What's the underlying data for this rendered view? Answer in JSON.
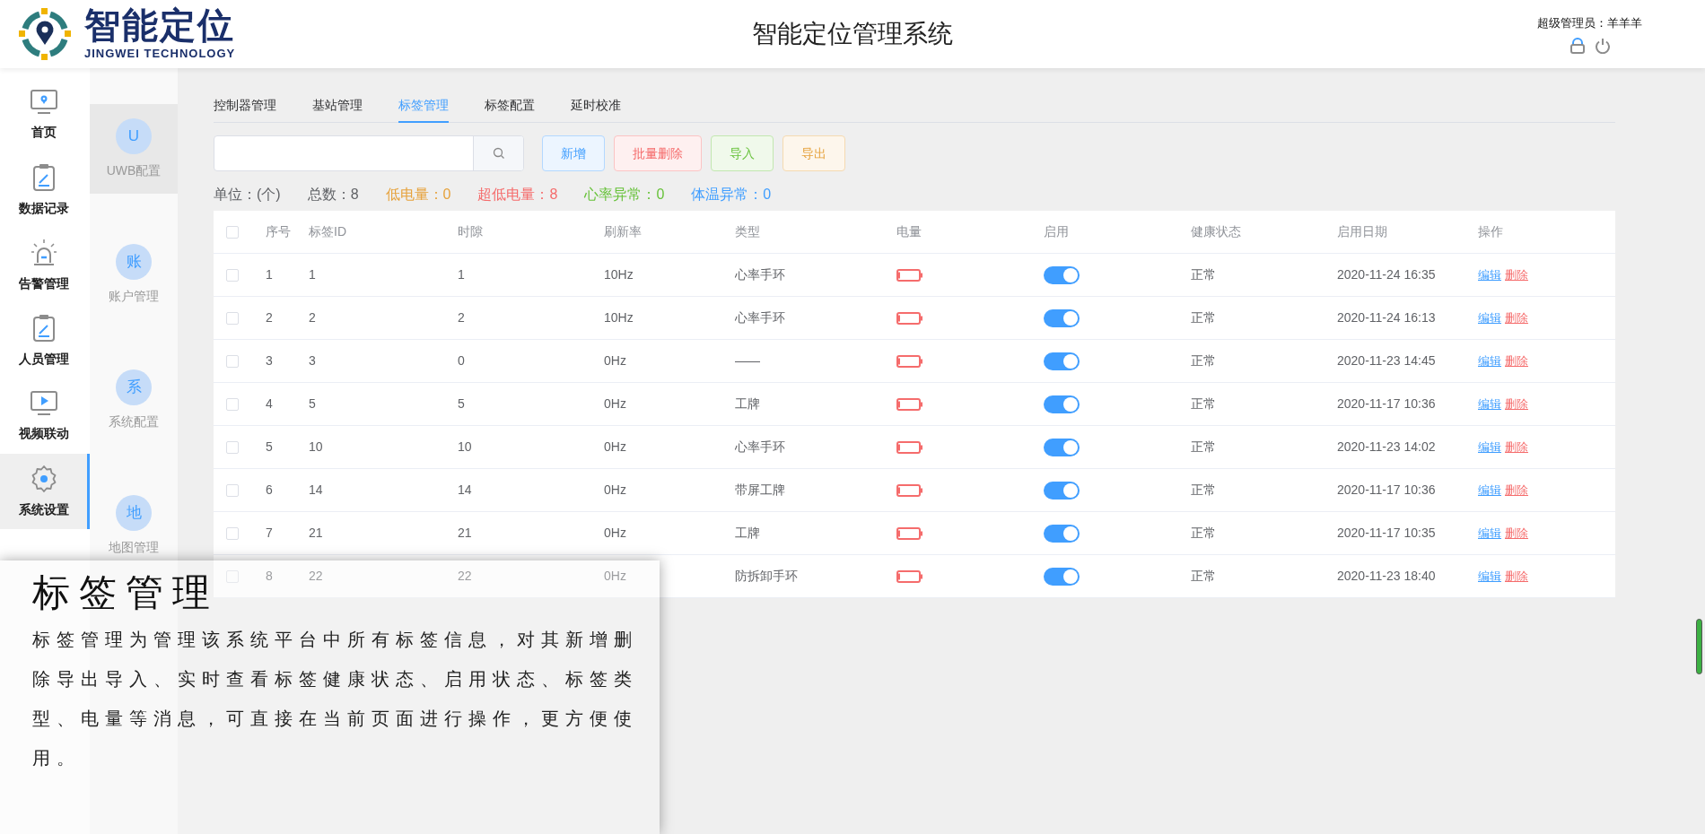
{
  "header": {
    "logo_text": "智能定位",
    "logo_subtitle": "JINGWEI TECHNOLOGY",
    "title": "智能定位管理系统",
    "user_label": "超级管理员：",
    "user_name": "羊羊羊"
  },
  "nav": [
    {
      "label": "首页",
      "kind": "monitor-pin",
      "selected": false
    },
    {
      "label": "数据记录",
      "kind": "clipboard",
      "selected": false
    },
    {
      "label": "告警管理",
      "kind": "alarm",
      "selected": false
    },
    {
      "label": "人员管理",
      "kind": "clipboard",
      "selected": false
    },
    {
      "label": "视频联动",
      "kind": "video",
      "selected": false
    },
    {
      "label": "系统设置",
      "kind": "gear",
      "selected": true
    }
  ],
  "subnav": [
    {
      "badge": "U",
      "label": "UWB配置",
      "selected": true
    },
    {
      "badge": "账",
      "label": "账户管理",
      "selected": false
    },
    {
      "badge": "系",
      "label": "系统配置",
      "selected": false
    },
    {
      "badge": "地",
      "label": "地图管理",
      "selected": false
    }
  ],
  "tabs": [
    {
      "label": "控制器管理",
      "selected": false
    },
    {
      "label": "基站管理",
      "selected": false
    },
    {
      "label": "标签管理",
      "selected": true
    },
    {
      "label": "标签配置",
      "selected": false
    },
    {
      "label": "延时校准",
      "selected": false
    }
  ],
  "buttons": [
    {
      "label": "新增",
      "kind": "primary"
    },
    {
      "label": "批量删除",
      "kind": "danger"
    },
    {
      "label": "导入",
      "kind": "success"
    },
    {
      "label": "导出",
      "kind": "warning"
    }
  ],
  "stats": [
    {
      "text": "单位：(个)",
      "color": "#606266"
    },
    {
      "text": "总数：8",
      "color": "#606266"
    },
    {
      "text": "低电量：0",
      "color": "#e6a23c"
    },
    {
      "text": "超低电量：8",
      "color": "#f56c6c"
    },
    {
      "text": "心率异常：0",
      "color": "#67c23a"
    },
    {
      "text": "体温异常：0",
      "color": "#409eff"
    }
  ],
  "table": {
    "header_checkbox": {
      "checked": false
    },
    "columns": [
      "序号",
      "标签ID",
      "时隙",
      "刷新率",
      "类型",
      "电量",
      "启用",
      "健康状态",
      "启用日期",
      "操作"
    ],
    "rows": [
      {
        "checked": false,
        "index": "1",
        "tag_id": "1",
        "slot": "1",
        "rate": "10Hz",
        "type": "心率手环",
        "battery": {
          "level": 0.1
        },
        "enabled": true,
        "health": "正常",
        "date": "2020-11-24 16:35",
        "actions": [
          "编辑",
          "删除"
        ]
      },
      {
        "checked": false,
        "index": "2",
        "tag_id": "2",
        "slot": "2",
        "rate": "10Hz",
        "type": "心率手环",
        "battery": {
          "level": 0.1
        },
        "enabled": true,
        "health": "正常",
        "date": "2020-11-24 16:13",
        "actions": [
          "编辑",
          "删除"
        ]
      },
      {
        "checked": false,
        "index": "3",
        "tag_id": "3",
        "slot": "0",
        "rate": "0Hz",
        "type": "——",
        "battery": {
          "level": 0.1
        },
        "enabled": true,
        "health": "正常",
        "date": "2020-11-23 14:45",
        "actions": [
          "编辑",
          "删除"
        ]
      },
      {
        "checked": false,
        "index": "4",
        "tag_id": "5",
        "slot": "5",
        "rate": "0Hz",
        "type": "工牌",
        "battery": {
          "level": 0.1
        },
        "enabled": true,
        "health": "正常",
        "date": "2020-11-17 10:36",
        "actions": [
          "编辑",
          "删除"
        ]
      },
      {
        "checked": false,
        "index": "5",
        "tag_id": "10",
        "slot": "10",
        "rate": "0Hz",
        "type": "心率手环",
        "battery": {
          "level": 0.1
        },
        "enabled": true,
        "health": "正常",
        "date": "2020-11-23 14:02",
        "actions": [
          "编辑",
          "删除"
        ]
      },
      {
        "checked": false,
        "index": "6",
        "tag_id": "14",
        "slot": "14",
        "rate": "0Hz",
        "type": "带屏工牌",
        "battery": {
          "level": 0.1
        },
        "enabled": true,
        "health": "正常",
        "date": "2020-11-17 10:36",
        "actions": [
          "编辑",
          "删除"
        ]
      },
      {
        "checked": false,
        "index": "7",
        "tag_id": "21",
        "slot": "21",
        "rate": "0Hz",
        "type": "工牌",
        "battery": {
          "level": 0.1
        },
        "enabled": true,
        "health": "正常",
        "date": "2020-11-17 10:35",
        "actions": [
          "编辑",
          "删除"
        ]
      },
      {
        "checked": false,
        "index": "8",
        "tag_id": "22",
        "slot": "22",
        "rate": "0Hz",
        "type": "防拆卸手环",
        "battery": {
          "level": 0.1
        },
        "enabled": true,
        "health": "正常",
        "date": "2020-11-23 18:40",
        "actions": [
          "编辑",
          "删除"
        ]
      }
    ]
  },
  "callout": {
    "title": "标签管理",
    "body": "标签管理为管理该系统平台中所有标签信息，对其新增删除导出导入、实时查看标签健康状态、启用状态、标签类型、电量等消息，可直接在当前页面进行操作，更方便使用。"
  }
}
